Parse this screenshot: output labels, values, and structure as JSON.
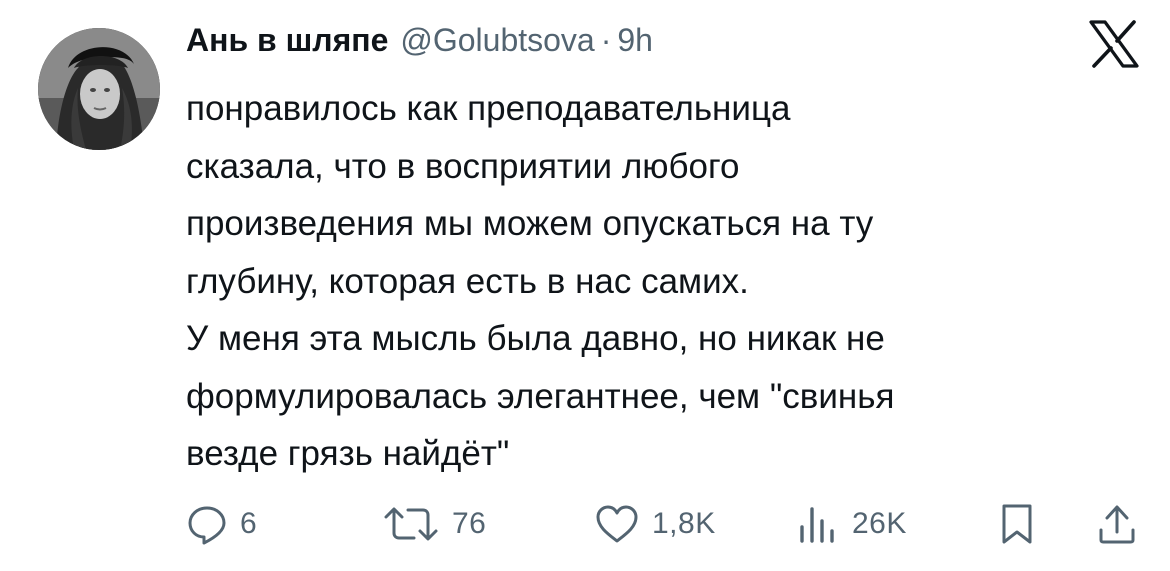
{
  "author": {
    "display_name": "Ань в шляпе",
    "handle": "@Golubtsova",
    "separator": "·",
    "time": "9h"
  },
  "tweet": {
    "lines": [
      "понравилось как преподавательница",
      "сказала, что в восприятии любого",
      "произведения мы можем опускаться на ту",
      "глубину, которая есть в нас самих.",
      "У меня эта мысль была давно, но никак не",
      "формулировалась элегантнее, чем \"свинья",
      "везде грязь найдёт\""
    ]
  },
  "actions": {
    "replies": "6",
    "reposts": "76",
    "likes": "1,8K",
    "views": "26K"
  },
  "icons": {
    "brand": "x-logo-icon",
    "reply": "reply-icon",
    "repost": "repost-icon",
    "like": "heart-icon",
    "views": "views-icon",
    "bookmark": "bookmark-icon",
    "share": "share-icon"
  },
  "colors": {
    "text": "#0f1419",
    "secondary": "#536471",
    "background": "#ffffff"
  }
}
